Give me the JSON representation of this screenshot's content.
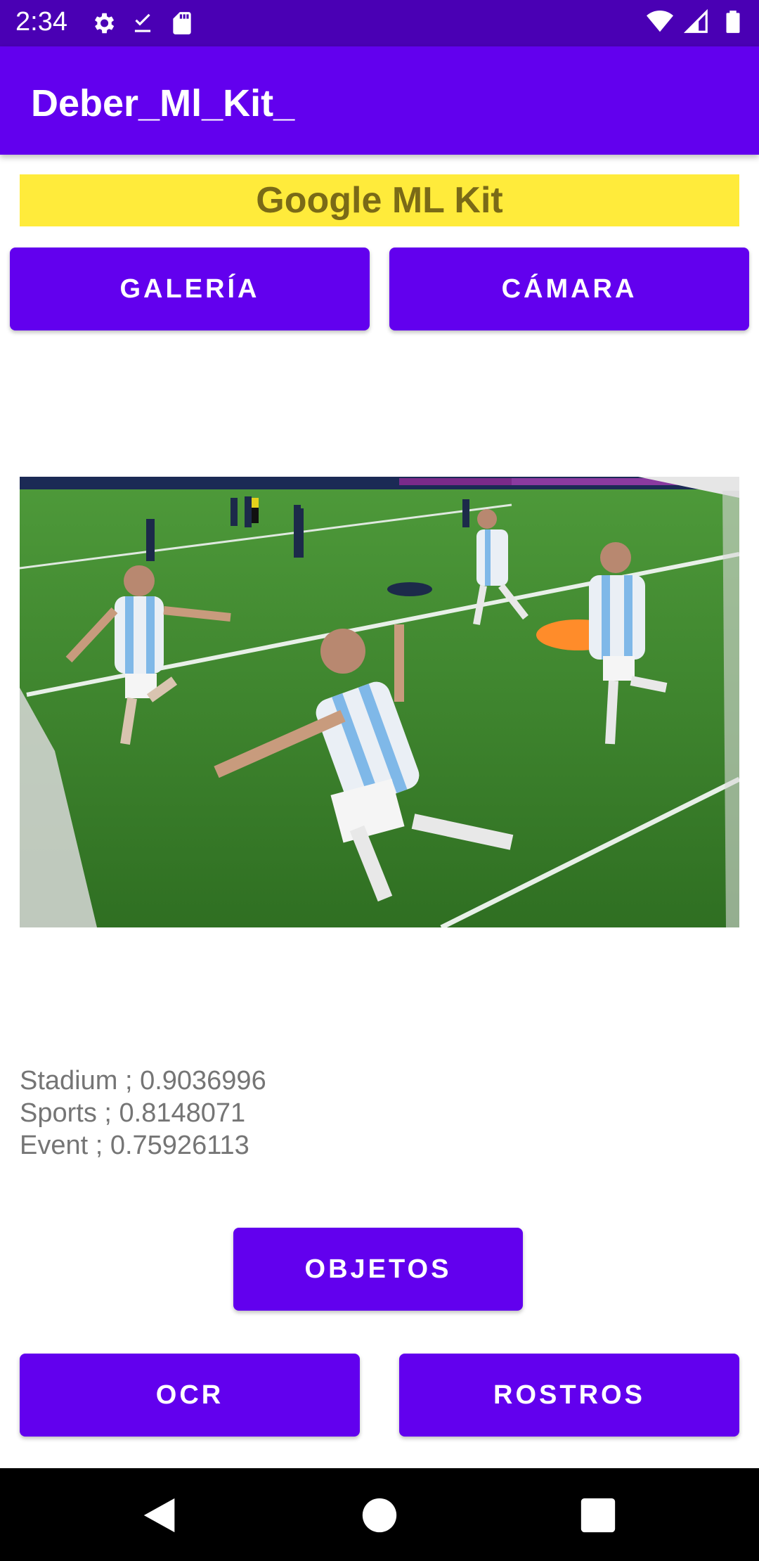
{
  "status_bar": {
    "time": "2:34",
    "icons_left": [
      "settings-icon",
      "download-done-icon",
      "sd-card-icon"
    ],
    "icons_right": [
      "wifi-icon",
      "signal-icon",
      "battery-icon"
    ]
  },
  "app_bar": {
    "title": "Deber_Ml_Kit_"
  },
  "banner": {
    "text": "Google ML Kit",
    "background": "#ffeb3b"
  },
  "buttons": {
    "gallery": "GALERÍA",
    "camera": "CÁMARA",
    "objects": "OBJETOS",
    "ocr": "OCR",
    "faces": "ROSTROS"
  },
  "results": [
    "Stadium ; 0.9036996",
    "Sports ; 0.8148071",
    "Event ; 0.75926113"
  ],
  "nav_bar": {
    "icons": [
      "back-icon",
      "home-icon",
      "recents-icon"
    ]
  },
  "colors": {
    "status_bar": "#4a00b4",
    "app_bar": "#6200ee",
    "button": "#6200ee",
    "result_text": "#757575"
  }
}
